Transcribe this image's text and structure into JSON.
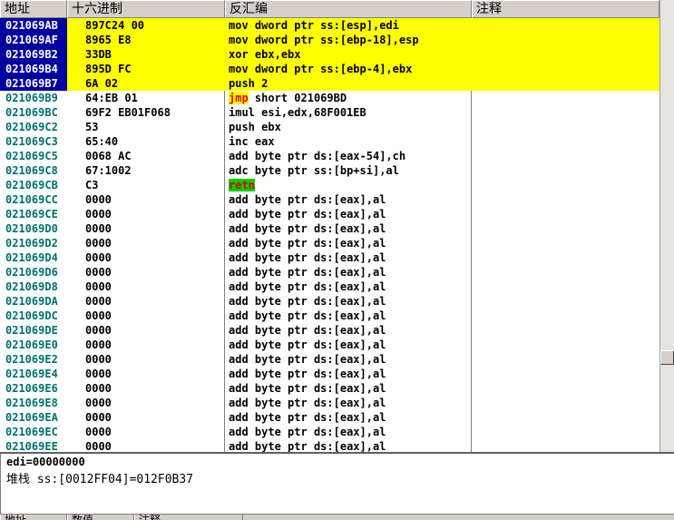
{
  "columns": {
    "address": "地址",
    "hex": "十六进制",
    "disasm": "反汇编",
    "comment": "注释"
  },
  "rows": [
    {
      "addr": "021069AB",
      "hex": "897C24 00",
      "mn": "mov",
      "ops": "dword ptr ss:[esp],edi",
      "hl": true,
      "sel": true
    },
    {
      "addr": "021069AF",
      "hex": "8965 E8",
      "mn": "mov",
      "ops": "dword ptr ss:[ebp-18],esp",
      "hl": true,
      "sel": true
    },
    {
      "addr": "021069B2",
      "hex": "33DB",
      "mn": "xor",
      "ops": "ebx,ebx",
      "hl": true,
      "sel": true
    },
    {
      "addr": "021069B4",
      "hex": "895D FC",
      "mn": "mov",
      "ops": "dword ptr ss:[ebp-4],ebx",
      "hl": true,
      "sel": true
    },
    {
      "addr": "021069B7",
      "hex": "6A 02",
      "mn": "push",
      "ops": "2",
      "hl": true,
      "sel": true
    },
    {
      "addr": "021069B9",
      "hex": "64:EB 01",
      "mn": "jmp",
      "ops": "short 021069BD",
      "style": "jmp"
    },
    {
      "addr": "021069BC",
      "hex": "69F2 EB01F068",
      "mn": "imul",
      "ops": "esi,edx,68F001EB"
    },
    {
      "addr": "021069C2",
      "hex": "53",
      "mn": "push",
      "ops": "ebx"
    },
    {
      "addr": "021069C3",
      "hex": "65:40",
      "mn": "inc",
      "ops": "eax"
    },
    {
      "addr": "021069C5",
      "hex": "0068 AC",
      "mn": "add",
      "ops": "byte ptr ds:[eax-54],ch"
    },
    {
      "addr": "021069C8",
      "hex": "67:1002",
      "mn": "adc",
      "ops": "byte ptr ss:[bp+si],al"
    },
    {
      "addr": "021069CB",
      "hex": "C3",
      "mn": "retn",
      "ops": "",
      "style": "ret"
    },
    {
      "addr": "021069CC",
      "hex": "0000",
      "mn": "add",
      "ops": "byte ptr ds:[eax],al"
    },
    {
      "addr": "021069CE",
      "hex": "0000",
      "mn": "add",
      "ops": "byte ptr ds:[eax],al"
    },
    {
      "addr": "021069D0",
      "hex": "0000",
      "mn": "add",
      "ops": "byte ptr ds:[eax],al"
    },
    {
      "addr": "021069D2",
      "hex": "0000",
      "mn": "add",
      "ops": "byte ptr ds:[eax],al"
    },
    {
      "addr": "021069D4",
      "hex": "0000",
      "mn": "add",
      "ops": "byte ptr ds:[eax],al"
    },
    {
      "addr": "021069D6",
      "hex": "0000",
      "mn": "add",
      "ops": "byte ptr ds:[eax],al"
    },
    {
      "addr": "021069D8",
      "hex": "0000",
      "mn": "add",
      "ops": "byte ptr ds:[eax],al"
    },
    {
      "addr": "021069DA",
      "hex": "0000",
      "mn": "add",
      "ops": "byte ptr ds:[eax],al"
    },
    {
      "addr": "021069DC",
      "hex": "0000",
      "mn": "add",
      "ops": "byte ptr ds:[eax],al"
    },
    {
      "addr": "021069DE",
      "hex": "0000",
      "mn": "add",
      "ops": "byte ptr ds:[eax],al"
    },
    {
      "addr": "021069E0",
      "hex": "0000",
      "mn": "add",
      "ops": "byte ptr ds:[eax],al"
    },
    {
      "addr": "021069E2",
      "hex": "0000",
      "mn": "add",
      "ops": "byte ptr ds:[eax],al"
    },
    {
      "addr": "021069E4",
      "hex": "0000",
      "mn": "add",
      "ops": "byte ptr ds:[eax],al"
    },
    {
      "addr": "021069E6",
      "hex": "0000",
      "mn": "add",
      "ops": "byte ptr ds:[eax],al"
    },
    {
      "addr": "021069E8",
      "hex": "0000",
      "mn": "add",
      "ops": "byte ptr ds:[eax],al"
    },
    {
      "addr": "021069EA",
      "hex": "0000",
      "mn": "add",
      "ops": "byte ptr ds:[eax],al"
    },
    {
      "addr": "021069EC",
      "hex": "0000",
      "mn": "add",
      "ops": "byte ptr ds:[eax],al"
    },
    {
      "addr": "021069EE",
      "hex": "0000",
      "mn": "add",
      "ops": "byte ptr ds:[eax],al"
    }
  ],
  "info": {
    "line1": "edi=00000000",
    "line2": "堆栈 ss:[0012FF04]=012F0B37"
  },
  "bottom_columns": {
    "address": "地址",
    "data": "数值",
    "comment": "注释"
  },
  "colors": {
    "highlight": "#ffff00",
    "selection": "#0000a0",
    "address_text": "#007070",
    "jump_mnemonic": "#e00000",
    "ret_background": "#00d000"
  }
}
